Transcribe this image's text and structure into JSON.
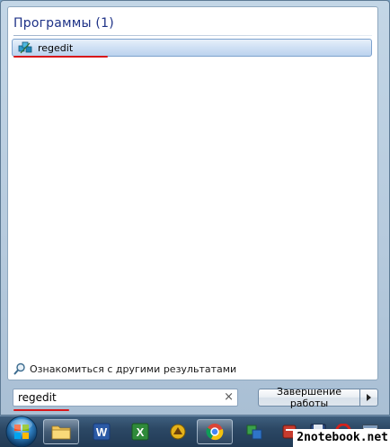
{
  "results": {
    "section_title": "Программы (1)",
    "items": [
      {
        "label": "regedit",
        "icon": "regedit-icon"
      }
    ]
  },
  "more_results_label": "Ознакомиться с другими результатами",
  "search": {
    "value": "regedit",
    "clear_glyph": "×"
  },
  "shutdown": {
    "label": "Завершение работы",
    "arrow_glyph": "▸"
  },
  "taskbar": {
    "items": [
      {
        "name": "explorer",
        "icon": "folder-icon"
      },
      {
        "name": "word",
        "icon": "word-icon",
        "glyph": "W"
      },
      {
        "name": "excel",
        "icon": "excel-icon",
        "glyph": "X"
      },
      {
        "name": "app-yellow",
        "icon": "yellow-app-icon"
      },
      {
        "name": "chrome",
        "icon": "chrome-icon"
      },
      {
        "name": "app-green",
        "icon": "green-app-icon"
      },
      {
        "name": "app-red",
        "icon": "red-app-icon"
      },
      {
        "name": "save",
        "icon": "floppy-icon"
      },
      {
        "name": "opera",
        "icon": "opera-icon"
      },
      {
        "name": "app-white",
        "icon": "window-icon"
      }
    ]
  },
  "watermark": "2notebook.net",
  "colors": {
    "accent_red": "#d8161a",
    "header_blue": "#1e3287",
    "selection": "#cfe0f4"
  }
}
